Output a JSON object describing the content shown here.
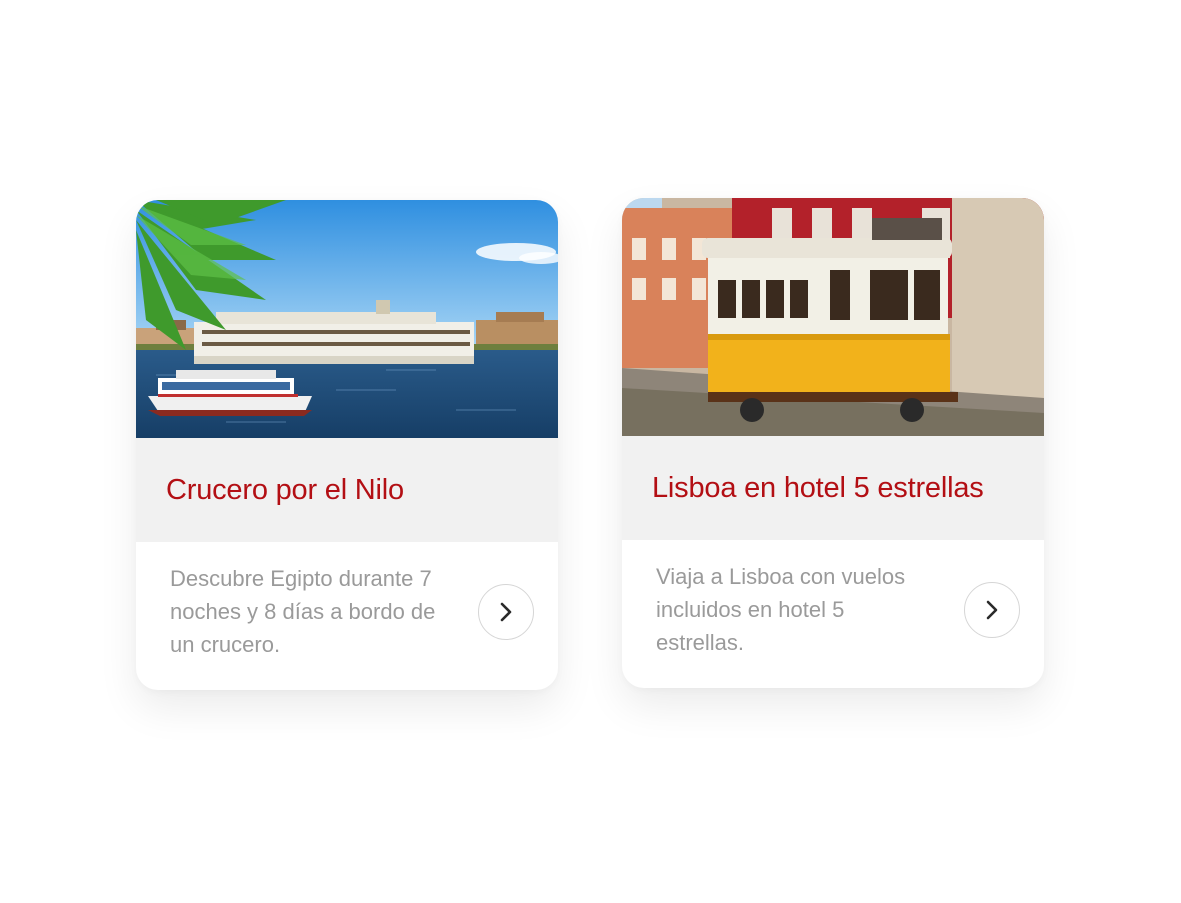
{
  "cards": [
    {
      "title": "Crucero por el Nilo",
      "description": "Descubre Egipto durante 7 noches y 8 días a bordo de un crucero.",
      "image": "nile-cruise-photo",
      "button_icon": "chevron-right-icon"
    },
    {
      "title": "Lisboa en hotel 5 estrellas",
      "description": "Viaja a Lisboa con vuelos incluidos en hotel 5 estrellas.",
      "image": "lisbon-tram-photo",
      "button_icon": "chevron-right-icon"
    }
  ],
  "colors": {
    "title": "#b30f14",
    "description": "#9a9a9a",
    "band": "#f1f1f1"
  }
}
